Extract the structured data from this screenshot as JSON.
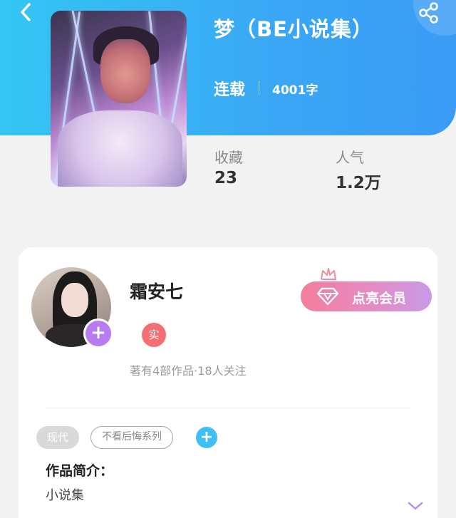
{
  "book": {
    "title": "梦（BE小说集）",
    "status": "连载",
    "word_count": "4001字",
    "stats": {
      "favorites_label": "收藏",
      "favorites_value": "23",
      "popularity_label": "人气",
      "popularity_value": "1.2万"
    }
  },
  "author": {
    "name": "霜安七",
    "verified_badge": "实",
    "meta": "著有4部作品·18人关注"
  },
  "vip": {
    "label": "点亮会员"
  },
  "tags": {
    "genre": "现代",
    "series": "不看后悔系列",
    "add": "+"
  },
  "intro": {
    "heading": "作品简介：",
    "text": "小说集"
  },
  "icons": {
    "back": "chevron-left-icon",
    "share": "share-icon",
    "crown": "crown-icon",
    "gem": "diamond-icon",
    "expand": "chevron-down-icon",
    "avatar_add": "plus-icon"
  },
  "colors": {
    "header_start": "#34c6f4",
    "header_end": "#3b9cf6",
    "vip_start": "#f37e9d",
    "vip_end": "#c89ae8",
    "avatar_plus": "#b67cf0",
    "verified": "#f36f73",
    "tag_add": "#3fbff2"
  }
}
